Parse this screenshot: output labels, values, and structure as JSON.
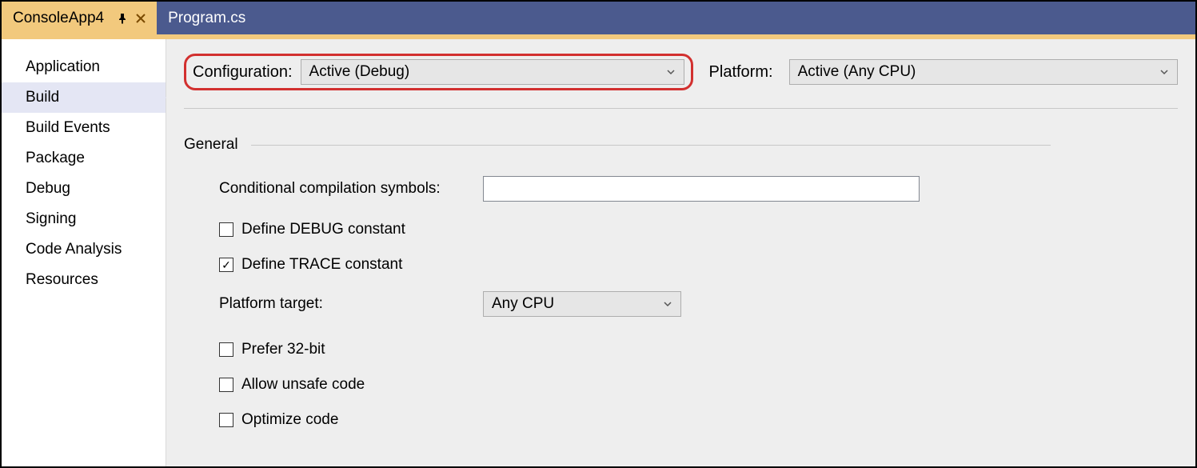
{
  "tabs": {
    "active": "ConsoleApp4",
    "inactive": "Program.cs"
  },
  "sidebar": {
    "items": [
      "Application",
      "Build",
      "Build Events",
      "Package",
      "Debug",
      "Signing",
      "Code Analysis",
      "Resources"
    ],
    "selected_index": 1
  },
  "toprow": {
    "config_label": "Configuration:",
    "config_value": "Active (Debug)",
    "platform_label": "Platform:",
    "platform_value": "Active (Any CPU)"
  },
  "section": {
    "title": "General"
  },
  "general": {
    "symbols_label": "Conditional compilation symbols:",
    "symbols_value": "",
    "define_debug_label": "Define DEBUG constant",
    "define_debug_checked": false,
    "define_trace_label": "Define TRACE constant",
    "define_trace_checked": true,
    "platform_target_label": "Platform target:",
    "platform_target_value": "Any CPU",
    "prefer_32_label": "Prefer 32-bit",
    "prefer_32_checked": false,
    "allow_unsafe_label": "Allow unsafe code",
    "allow_unsafe_checked": false,
    "optimize_label": "Optimize code",
    "optimize_checked": false
  }
}
